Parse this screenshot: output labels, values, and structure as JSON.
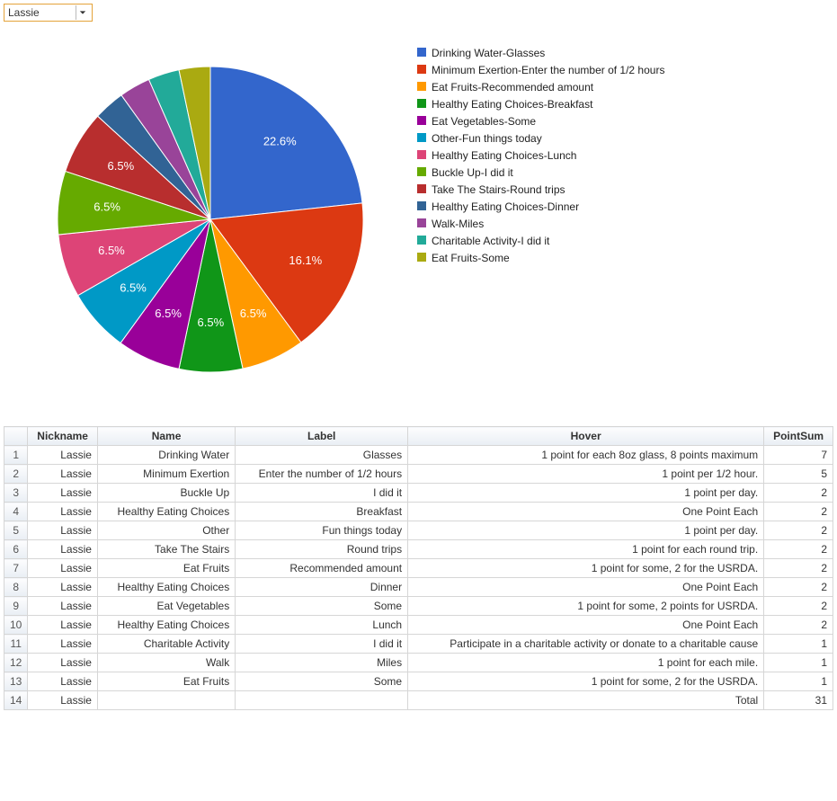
{
  "dropdown": {
    "value": "Lassie"
  },
  "chart_data": {
    "type": "pie",
    "title": "",
    "series": [
      {
        "name": "Drinking Water-Glasses",
        "value": 22.6,
        "color": "#3366cc"
      },
      {
        "name": "Minimum Exertion-Enter the number of 1/2 hours",
        "value": 16.1,
        "color": "#dc3912"
      },
      {
        "name": "Eat Fruits-Recommended amount",
        "value": 6.5,
        "color": "#ff9900"
      },
      {
        "name": "Healthy Eating Choices-Breakfast",
        "value": 6.5,
        "color": "#109618"
      },
      {
        "name": "Eat Vegetables-Some",
        "value": 6.5,
        "color": "#990099"
      },
      {
        "name": "Other-Fun things today",
        "value": 6.5,
        "color": "#0099c6"
      },
      {
        "name": "Healthy Eating Choices-Lunch",
        "value": 6.5,
        "color": "#dd4477"
      },
      {
        "name": "Buckle Up-I did it",
        "value": 6.5,
        "color": "#66aa00"
      },
      {
        "name": "Take The Stairs-Round trips",
        "value": 6.5,
        "color": "#b82e2e"
      },
      {
        "name": "Healthy Eating Choices-Dinner",
        "value": 3.2,
        "color": "#316395"
      },
      {
        "name": "Walk-Miles",
        "value": 3.2,
        "color": "#994499"
      },
      {
        "name": "Charitable Activity-I did it",
        "value": 3.2,
        "color": "#22aa99"
      },
      {
        "name": "Eat Fruits-Some",
        "value": 3.2,
        "color": "#aaaa11"
      }
    ],
    "label_threshold_percent": 6.0,
    "legend_position": "right"
  },
  "table": {
    "headers": {
      "nickname": "Nickname",
      "name": "Name",
      "label": "Label",
      "hover": "Hover",
      "pointsum": "PointSum"
    },
    "rows": [
      {
        "n": "1",
        "nickname": "Lassie",
        "name": "Drinking Water",
        "label": "Glasses",
        "hover": "1 point for each 8oz glass, 8 points maximum",
        "pointsum": "7"
      },
      {
        "n": "2",
        "nickname": "Lassie",
        "name": "Minimum Exertion",
        "label": "Enter the number of 1/2 hours",
        "hover": "1 point per 1/2 hour.",
        "pointsum": "5"
      },
      {
        "n": "3",
        "nickname": "Lassie",
        "name": "Buckle Up",
        "label": "I did it",
        "hover": "1 point per day.",
        "pointsum": "2"
      },
      {
        "n": "4",
        "nickname": "Lassie",
        "name": "Healthy Eating Choices",
        "label": "Breakfast",
        "hover": "One Point Each",
        "pointsum": "2"
      },
      {
        "n": "5",
        "nickname": "Lassie",
        "name": "Other",
        "label": "Fun things today",
        "hover": "1 point per day.",
        "pointsum": "2"
      },
      {
        "n": "6",
        "nickname": "Lassie",
        "name": "Take The Stairs",
        "label": "Round trips",
        "hover": "1 point for each round trip.",
        "pointsum": "2"
      },
      {
        "n": "7",
        "nickname": "Lassie",
        "name": "Eat Fruits",
        "label": "Recommended amount",
        "hover": "1 point for some, 2 for the USRDA.",
        "pointsum": "2"
      },
      {
        "n": "8",
        "nickname": "Lassie",
        "name": "Healthy Eating Choices",
        "label": "Dinner",
        "hover": "One Point Each",
        "pointsum": "2"
      },
      {
        "n": "9",
        "nickname": "Lassie",
        "name": "Eat Vegetables",
        "label": "Some",
        "hover": "1 point for some, 2 points for USRDA.",
        "pointsum": "2"
      },
      {
        "n": "10",
        "nickname": "Lassie",
        "name": "Healthy Eating Choices",
        "label": "Lunch",
        "hover": "One Point Each",
        "pointsum": "2"
      },
      {
        "n": "11",
        "nickname": "Lassie",
        "name": "Charitable Activity",
        "label": "I did it",
        "hover": "Participate in a charitable activity or donate to a charitable cause",
        "pointsum": "1"
      },
      {
        "n": "12",
        "nickname": "Lassie",
        "name": "Walk",
        "label": "Miles",
        "hover": "1 point for each mile.",
        "pointsum": "1"
      },
      {
        "n": "13",
        "nickname": "Lassie",
        "name": "Eat Fruits",
        "label": "Some",
        "hover": "1 point for some, 2 for the USRDA.",
        "pointsum": "1"
      },
      {
        "n": "14",
        "nickname": "Lassie",
        "name": "",
        "label": "",
        "hover": "Total",
        "pointsum": "31"
      }
    ]
  }
}
